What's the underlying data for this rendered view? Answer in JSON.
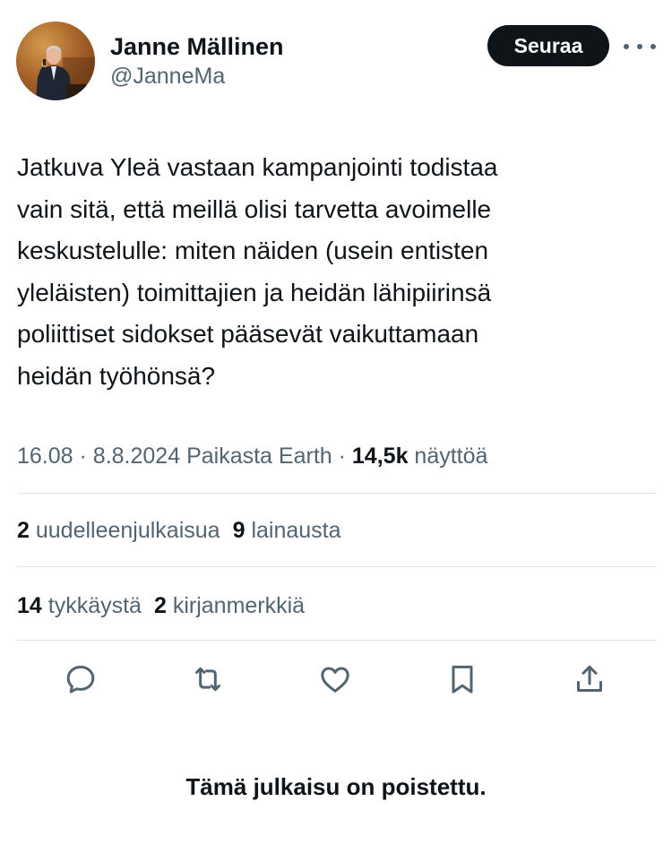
{
  "author": {
    "display_name": "Janne Mällinen",
    "handle": "@JanneMa",
    "avatar_icon": "speaker-photo-avatar"
  },
  "follow_button": {
    "label": "Seuraa"
  },
  "more_menu": {
    "icon": "more-dots-icon"
  },
  "tweet": {
    "text": "Jatkuva Yleä vastaan kampanjointi todistaa\nvain sitä, että meillä olisi tarvetta avoimelle\nkeskustelulle: miten näiden (usein entisten\nyleläisten) toimittajien ja heidän lähipiirinsä\npoliittiset sidokset pääsevät vaikuttamaan\nheidän työhönsä?"
  },
  "meta": {
    "time": "16.08",
    "separator": "·",
    "date": "8.8.2024",
    "location": "Paikasta Earth",
    "views_count": "14,5k",
    "views_label": "näyttöä"
  },
  "stats": {
    "reposts_count": "2",
    "reposts_label": "uudelleenjulkaisua",
    "quotes_count": "9",
    "quotes_label": "lainausta",
    "likes_count": "14",
    "likes_label": "tykkäystä",
    "bookmarks_count": "2",
    "bookmarks_label": "kirjanmerkkiä"
  },
  "actions": [
    {
      "icon": "reply-icon"
    },
    {
      "icon": "repost-icon"
    },
    {
      "icon": "like-icon"
    },
    {
      "icon": "bookmark-icon"
    },
    {
      "icon": "share-icon"
    }
  ],
  "colors": {
    "text_primary": "#0f1419",
    "text_secondary": "#536471",
    "divider": "#dfe3e6",
    "button_bg": "#0f1419",
    "button_text": "#ffffff"
  },
  "notice": {
    "text": "Tämä julkaisu on poistettu."
  }
}
